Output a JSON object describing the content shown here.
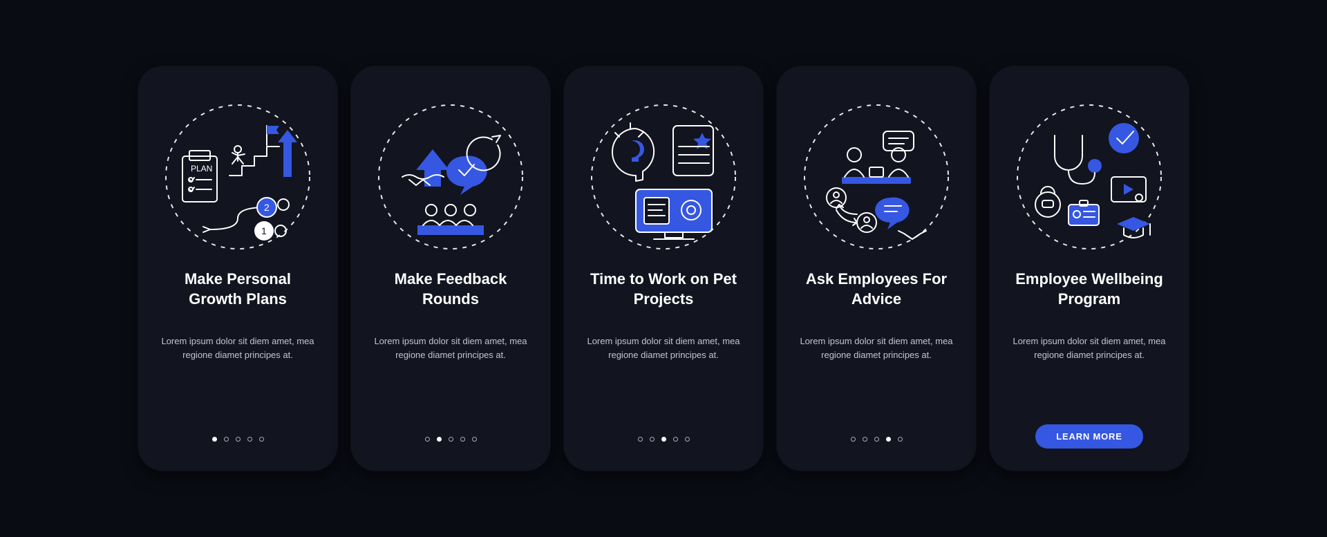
{
  "colors": {
    "background": "#0a0c14",
    "card": "#12141f",
    "accent": "#3657e2",
    "text": "#ffffff"
  },
  "placeholder_body": "Lorem ipsum dolor sit diem amet, mea regione diamet principes at.",
  "cta_label": "LEARN MORE",
  "slides": [
    {
      "title": "Make Personal Growth Plans",
      "icon": "growth-plan-icon",
      "active_dot": 0,
      "has_cta": false
    },
    {
      "title": "Make Feedback Rounds",
      "icon": "feedback-icon",
      "active_dot": 1,
      "has_cta": false
    },
    {
      "title": "Time to Work on Pet Projects",
      "icon": "pet-projects-icon",
      "active_dot": 2,
      "has_cta": false
    },
    {
      "title": "Ask Employees For Advice",
      "icon": "advice-icon",
      "active_dot": 3,
      "has_cta": false
    },
    {
      "title": "Employee Wellbeing Program",
      "icon": "wellbeing-icon",
      "active_dot": 4,
      "has_cta": true
    }
  ]
}
